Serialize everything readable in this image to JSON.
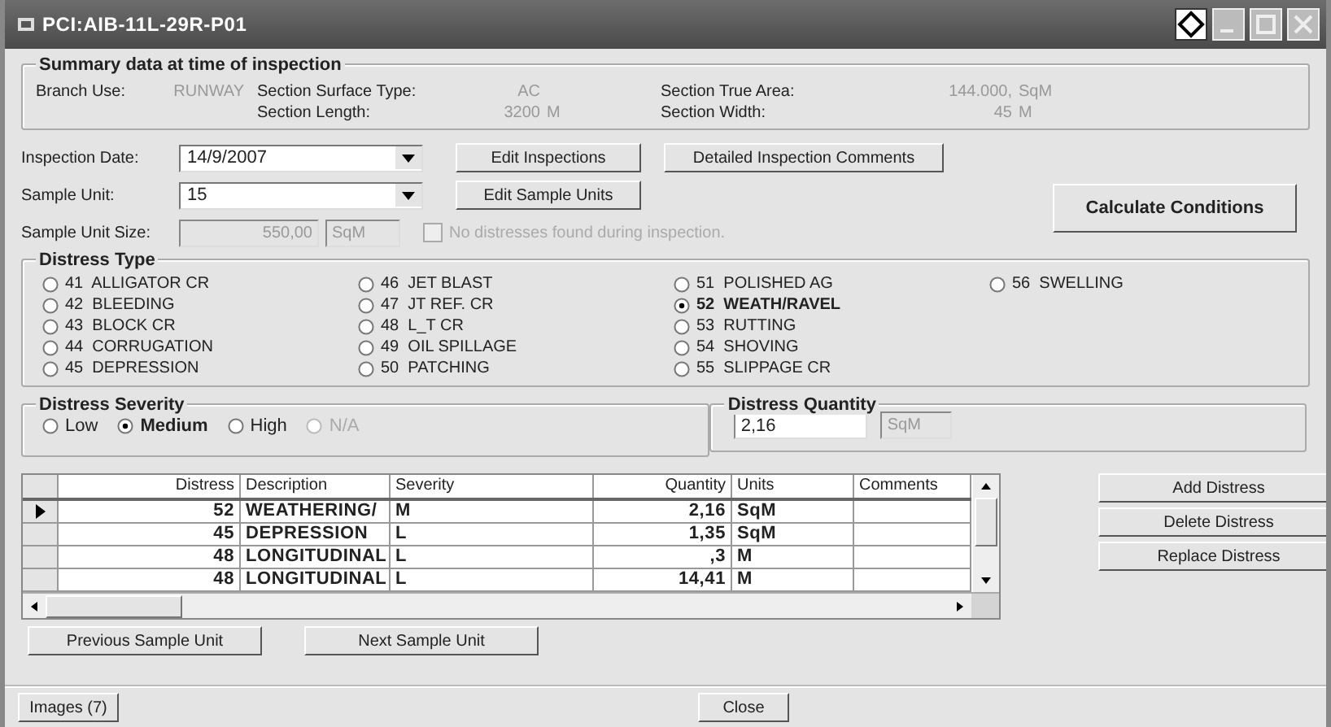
{
  "window": {
    "title": "PCI:AIB-11L-29R-P01"
  },
  "summary": {
    "title": "Summary data at time of inspection",
    "branch": {
      "label": "Branch Use:",
      "value": "RUNWAY"
    },
    "fields": [
      {
        "label": "Section Surface Type:",
        "value": "AC"
      },
      {
        "label": "Section True Area:",
        "value": "144.000,",
        "unit": "SqM"
      },
      {
        "label": "Section Length:",
        "value": "3200",
        "unit": "M"
      },
      {
        "label": "Section Width:",
        "value": "45",
        "unit": "M"
      }
    ]
  },
  "inspection_date": {
    "label": "Inspection Date:",
    "value": "14/9/2007"
  },
  "sample_unit": {
    "label": "Sample Unit:",
    "value": "15"
  },
  "sample_unit_size": {
    "label": "Sample Unit Size:",
    "value": "550,00",
    "unit": "SqM"
  },
  "no_distress": {
    "label": "No distresses found during inspection.",
    "checked": false,
    "disabled": true
  },
  "buttons": {
    "edit_inspections": "Edit Inspections",
    "detailed_comments": "Detailed Inspection Comments",
    "edit_sample_units": "Edit Sample Units",
    "calculate": "Calculate Conditions"
  },
  "distress_type": {
    "title": "Distress Type",
    "options": [
      {
        "label": "41  ALLIGATOR CR",
        "selected": false
      },
      {
        "label": "42  BLEEDING",
        "selected": false
      },
      {
        "label": "43  BLOCK CR",
        "selected": false
      },
      {
        "label": "44  CORRUGATION",
        "selected": false
      },
      {
        "label": "45  DEPRESSION",
        "selected": false
      },
      {
        "label": "46  JET BLAST",
        "selected": false
      },
      {
        "label": "47  JT REF. CR",
        "selected": false
      },
      {
        "label": "48  L_T CR",
        "selected": false
      },
      {
        "label": "49  OIL SPILLAGE",
        "selected": false
      },
      {
        "label": "50  PATCHING",
        "selected": false
      },
      {
        "label": "51  POLISHED AG",
        "selected": false
      },
      {
        "label": "52  WEATH/RAVEL",
        "selected": true
      },
      {
        "label": "53  RUTTING",
        "selected": false
      },
      {
        "label": "54  SHOVING",
        "selected": false
      },
      {
        "label": "55  SLIPPAGE CR",
        "selected": false
      },
      {
        "label": "56  SWELLING",
        "selected": false
      }
    ]
  },
  "severity": {
    "title": "Distress Severity",
    "options": [
      {
        "label": "Low",
        "selected": false,
        "disabled": false
      },
      {
        "label": "Medium",
        "selected": true,
        "disabled": false
      },
      {
        "label": "High",
        "selected": false,
        "disabled": false
      },
      {
        "label": "N/A",
        "selected": false,
        "disabled": true
      }
    ]
  },
  "quantity": {
    "title": "Distress Quantity",
    "value": "2,16",
    "unit": "SqM"
  },
  "table": {
    "columns": [
      "Distress",
      "Description",
      "Severity",
      "Quantity",
      "Units",
      "Comments"
    ],
    "rows": [
      {
        "current": true,
        "cells": [
          "52",
          "WEATHERING/",
          "M",
          "2,16",
          "SqM",
          ""
        ]
      },
      {
        "current": false,
        "cells": [
          "45",
          "DEPRESSION",
          "L",
          "1,35",
          "SqM",
          ""
        ]
      },
      {
        "current": false,
        "cells": [
          "48",
          "LONGITUDINAL",
          "L",
          ",3",
          "M",
          ""
        ]
      },
      {
        "current": false,
        "cells": [
          "48",
          "LONGITUDINAL",
          "L",
          "14,41",
          "M",
          ""
        ]
      }
    ]
  },
  "side_buttons": [
    "Add Distress",
    "Delete Distress",
    "Replace Distress"
  ],
  "nav_buttons": [
    "Previous Sample Unit",
    "Next Sample Unit"
  ],
  "footer_buttons": [
    "Images (7)",
    "Close"
  ]
}
